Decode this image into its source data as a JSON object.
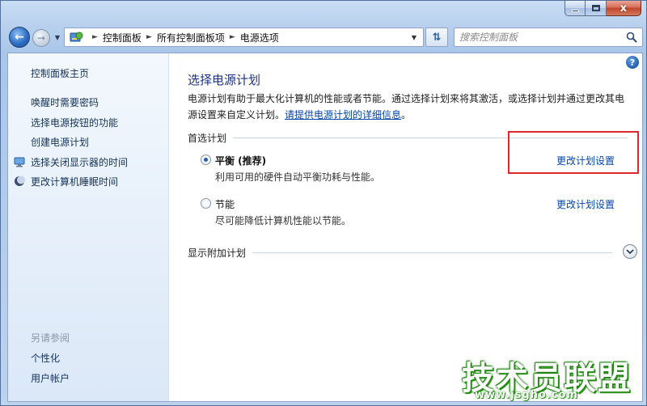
{
  "window": {
    "caption_minimize": "minimize-button",
    "caption_maximize": "maximize-button",
    "caption_close": "x"
  },
  "nav": {
    "breadcrumbs": [
      "控制面板",
      "所有控制面板项",
      "电源选项"
    ],
    "search_placeholder": "搜索控制面板"
  },
  "sidebar": {
    "home": "控制面板主页",
    "links": [
      "唤醒时需要密码",
      "选择电源按钮的功能",
      "创建电源计划",
      "选择关闭显示器的时间",
      "更改计算机睡眠时间"
    ],
    "see_also_heading": "另请参阅",
    "see_also_links": [
      "个性化",
      "用户帐户"
    ]
  },
  "main": {
    "title": "选择电源计划",
    "intro_text": "电源计划有助于最大化计算机的性能或者节能。通过选择计划来将其激活，或选择计划并通过更改其电源设置来自定义计划。",
    "intro_link": "请提供电源计划的详细信息",
    "intro_end": "。",
    "preferred_heading": "首选计划",
    "plans": [
      {
        "name": "平衡 (推荐)",
        "desc": "利用可用的硬件自动平衡功耗与性能。",
        "link": "更改计划设置",
        "selected": true
      },
      {
        "name": "节能",
        "desc": "尽可能降低计算机性能以节能。",
        "link": "更改计划设置",
        "selected": false
      }
    ],
    "more_plans": "显示附加计划"
  },
  "watermark": {
    "text": "技术员联盟",
    "url": "www.jsgho.com"
  },
  "colors": {
    "title_blue": "#1e3287",
    "link_blue": "#0645ad",
    "highlight_red": "#e0272d"
  }
}
